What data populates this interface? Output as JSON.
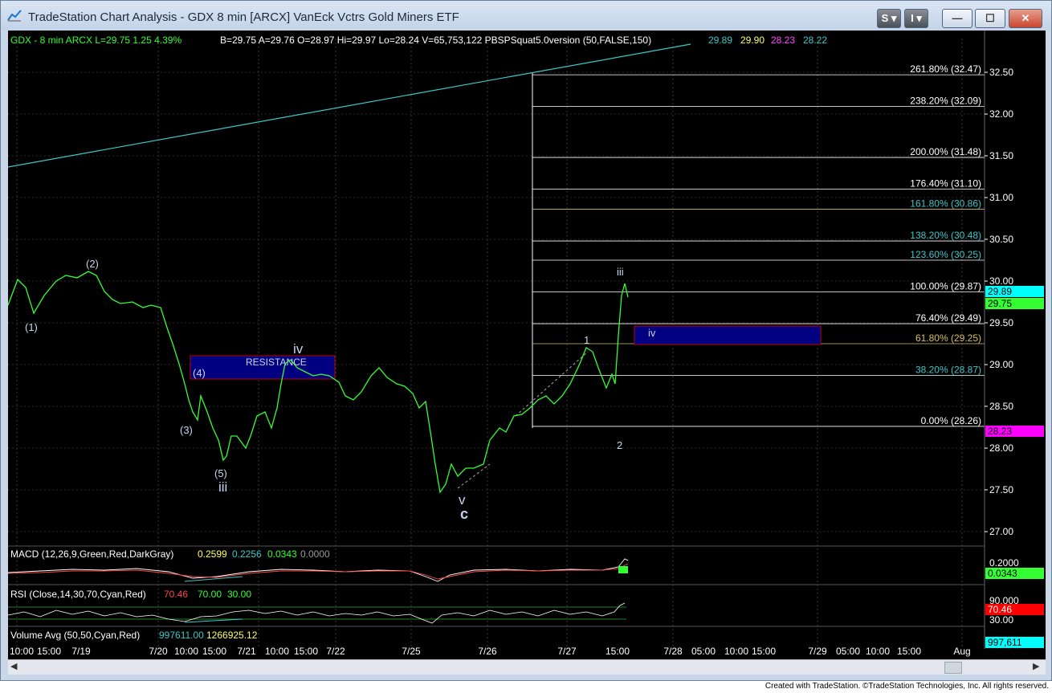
{
  "window": {
    "title": "TradeStation Chart Analysis - GDX 8 min [ARCX] VanEck Vctrs Gold Miners ETF",
    "btn_s": "S",
    "btn_i": "I",
    "btn_min": "—",
    "btn_max": "☐",
    "btn_close": "✕"
  },
  "colors": {
    "price": "#33ff33",
    "trendline": "#3cc8c8",
    "fib_line": "#ffffff",
    "fib_618": "#d4c060",
    "box_fill": "#000080",
    "box_border": "#c00000"
  },
  "header": {
    "symbol": "GDX - 8 min  ARCX  L=29.75  1.25  4.39%",
    "bid": "B=29.75  A=29.76  O=28.97  Hi=29.97  Lo=28.24  V=65,753,122  PBSPSquat5.0version (50,FALSE,150)",
    "ind1": "29.89",
    "ind2": "29.90",
    "ind3": "28.23",
    "ind4": "28.22"
  },
  "price_axis": {
    "ticks": [
      "32.50",
      "32.00",
      "31.50",
      "31.00",
      "30.50",
      "30.00",
      "29.50",
      "29.00",
      "28.50",
      "28.00",
      "27.50",
      "27.00"
    ],
    "last_cyan": "29.89",
    "last_green": "29.75",
    "last_magenta": "28.23"
  },
  "fib_levels": [
    {
      "label": "261.80% (32.47)",
      "price": 32.47
    },
    {
      "label": "238.20% (32.09)",
      "price": 32.09
    },
    {
      "label": "200.00% (31.48)",
      "price": 31.48
    },
    {
      "label": "176.40% (31.10)",
      "price": 31.1
    },
    {
      "label": "161.80% (30.86)",
      "price": 30.86
    },
    {
      "label": "138.20% (30.48)",
      "price": 30.48
    },
    {
      "label": "123.60% (30.25)",
      "price": 30.25
    },
    {
      "label": "100.00% (29.87)",
      "price": 29.87
    },
    {
      "label": "76.40% (29.49)",
      "price": 29.49
    },
    {
      "label": "61.80% (29.25)",
      "price": 29.25
    },
    {
      "label": "38.20% (28.87)",
      "price": 28.87
    },
    {
      "label": "0.00% (28.26)",
      "price": 28.26
    }
  ],
  "wave_labels": {
    "w1": "(1)",
    "w2": "(2)",
    "w3": "(3)",
    "w4": "(4)",
    "w5": "(5)",
    "iii_a": "iii",
    "iv_a": "iv",
    "v": "v",
    "c": "c",
    "n1": "1",
    "n2": "2",
    "iii_b": "iii",
    "iv_b": "iv"
  },
  "resistance_label": "RESISTANCE",
  "macd": {
    "label": "MACD (12,26,9,Green,Red,DarkGray)",
    "v1": "0.2599",
    "v2": "0.2256",
    "v3": "0.0343",
    "v4": "0.0000",
    "axis_top": "0.2000",
    "axis_val": "0.0343"
  },
  "rsi": {
    "label": "RSI (Close,14,30,70,Cyan,Red)",
    "v1": "70.46",
    "v2": "70.00",
    "v3": "30.00",
    "axis_90": "90.000",
    "axis_val": "70.46",
    "axis_30": "30.00"
  },
  "volume": {
    "label": "Volume Avg (50,50,Cyan,Red)",
    "v1": "997611.00",
    "v2": "1266925.12",
    "axis_val": "997,611"
  },
  "time_axis": [
    "10:00",
    "15:00",
    "7/19",
    "7/20",
    "10:00",
    "15:00",
    "7/21",
    "10:00",
    "15:00",
    "7/22",
    "7/25",
    "7/26",
    "7/27",
    "15:00",
    "7/28",
    "05:00",
    "10:00",
    "15:00",
    "7/29",
    "05:00",
    "10:00",
    "15:00",
    "Aug"
  ],
  "footer": "Created with TradeStation. ©TradeStation Technologies, Inc. All rights reserved."
}
